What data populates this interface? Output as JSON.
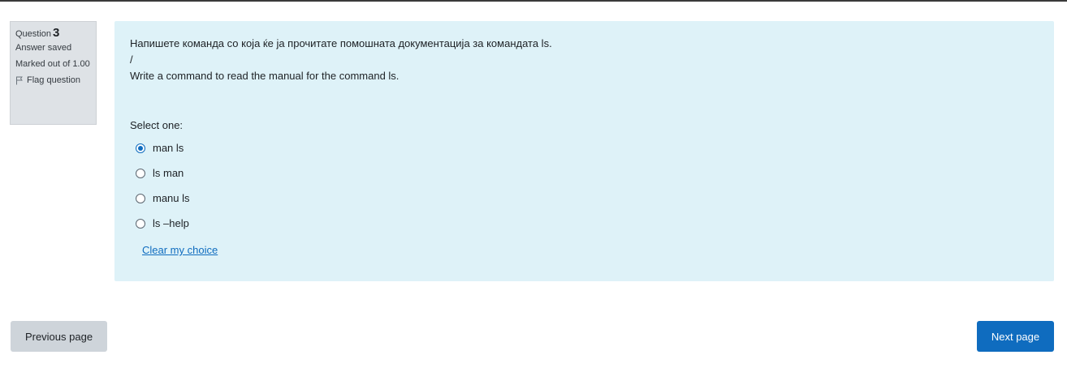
{
  "question_info": {
    "question_label": "Question",
    "question_number": "3",
    "state": "Answer saved",
    "grade": "Marked out of 1.00",
    "flag_label": "Flag question"
  },
  "question": {
    "text_mk": "Напишете команда со која ќе ја прочитате помошната документација за командата ls.",
    "separator": "/",
    "text_en": "Write a command to read the manual for the command ls.",
    "prompt": "Select one:",
    "options": [
      {
        "label": "man ls",
        "selected": true
      },
      {
        "label": "ls man",
        "selected": false
      },
      {
        "label": "manu ls",
        "selected": false
      },
      {
        "label": "ls –help",
        "selected": false
      }
    ],
    "clear_label": "Clear my choice"
  },
  "navigation": {
    "previous_label": "Previous page",
    "next_label": "Next page"
  },
  "colors": {
    "accent": "#0f6cbf",
    "panel_bg": "#def2f8",
    "info_bg": "#dee2e6",
    "secondary_button": "#ced4da"
  }
}
